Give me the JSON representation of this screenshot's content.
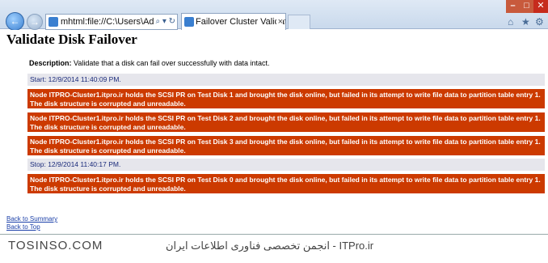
{
  "browser": {
    "address": "mhtml:file://C:\\Users\\Adminis",
    "address_tools": "⌕ ▾ ↻",
    "tab_title": "Failover Cluster Validation ...",
    "tab_close": "×",
    "back_glyph": "←",
    "forward_glyph": "→",
    "min_glyph": "–",
    "max_glyph": "□",
    "close_glyph": "✕",
    "home_glyph": "⌂",
    "star_glyph": "★",
    "gear_glyph": "⚙"
  },
  "page": {
    "title": "Validate Disk Failover",
    "description_label": "Description:",
    "description_text": " Validate that a disk can fail over successfully with data intact.",
    "rows": [
      {
        "kind": "grey",
        "text": "Start: 12/9/2014 11:40:09 PM."
      },
      {
        "kind": "red",
        "text": "Node ITPRO-Cluster1.itpro.ir holds the SCSI PR on Test Disk 1 and brought the disk online, but failed in its attempt to write file data to partition table entry 1. The disk structure is corrupted and unreadable."
      },
      {
        "kind": "red",
        "text": "Node ITPRO-Cluster1.itpro.ir holds the SCSI PR on Test Disk 2 and brought the disk online, but failed in its attempt to write file data to partition table entry 1. The disk structure is corrupted and unreadable."
      },
      {
        "kind": "red",
        "text": "Node ITPRO-Cluster1.itpro.ir holds the SCSI PR on Test Disk 3 and brought the disk online, but failed in its attempt to write file data to partition table entry 1. The disk structure is corrupted and unreadable."
      },
      {
        "kind": "grey",
        "text": "Stop: 12/9/2014 11:40:17 PM."
      },
      {
        "kind": "red",
        "text": "Node ITPRO-Cluster1.itpro.ir holds the SCSI PR on Test Disk 0 and brought the disk online, but failed in its attempt to write file data to partition table entry 1. The disk structure is corrupted and unreadable."
      }
    ],
    "back_to_summary": "Back to Summary",
    "back_to_top": "Back to Top"
  },
  "watermark": {
    "left": "TOSINSO.COM",
    "right": "ITPro.ir - انجمن تخصصی فناوری اطلاعات ایران"
  },
  "colors": {
    "error_row": "#cc3a00",
    "info_row": "#e6e6ec",
    "link": "#1a3fa8"
  }
}
